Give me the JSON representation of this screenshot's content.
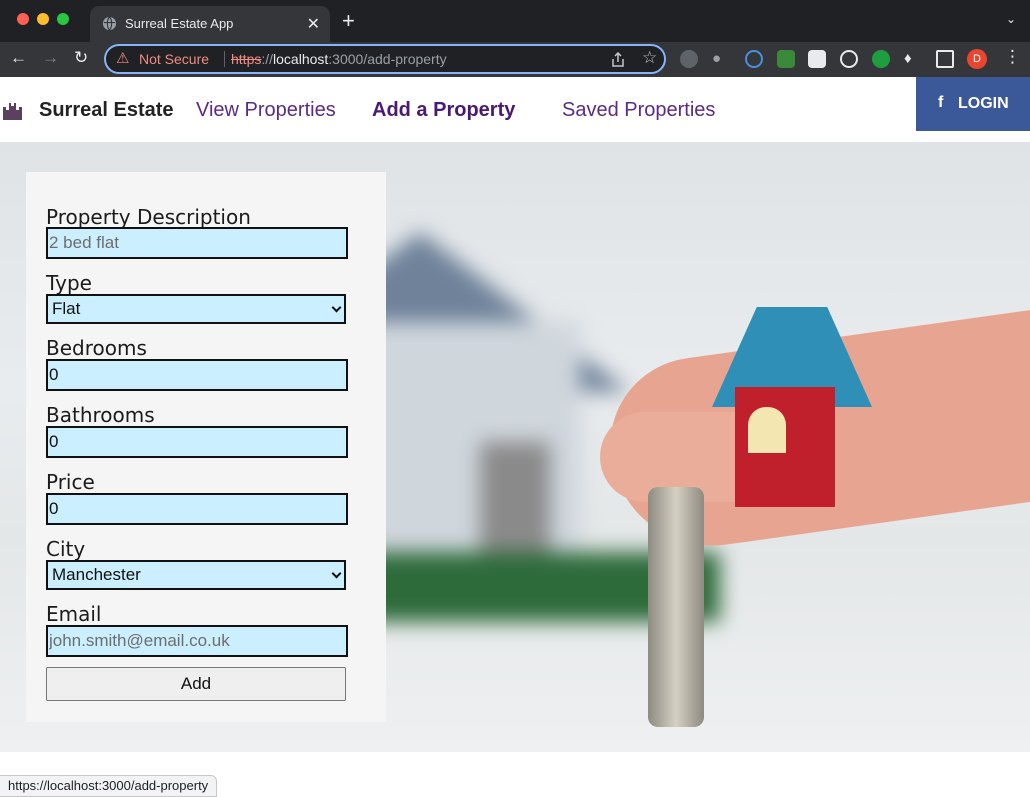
{
  "browser": {
    "tab": {
      "title": "Surreal Estate App",
      "close": "✕"
    },
    "new_tab": "+",
    "tab_menu": "⌄",
    "security_label": "Not Secure",
    "url": {
      "scheme": "https",
      "sep": "://",
      "host": "localhost",
      "rest": ":3000/add-property"
    },
    "profile_initial": "D",
    "status_url": "https://localhost:3000/add-property"
  },
  "nav": {
    "brand": "Surreal Estate",
    "links": [
      {
        "label": "View Properties"
      },
      {
        "label": "Add a Property"
      },
      {
        "label": "Saved Properties"
      }
    ],
    "login": {
      "label": "LOGIN",
      "icon": "f"
    }
  },
  "form": {
    "fields": {
      "description": {
        "label": "Property Description",
        "placeholder": "2 bed flat"
      },
      "type": {
        "label": "Type",
        "value": "Flat"
      },
      "bedrooms": {
        "label": "Bedrooms",
        "value": "0"
      },
      "bathrooms": {
        "label": "Bathrooms",
        "value": "0"
      },
      "price": {
        "label": "Price",
        "value": "0"
      },
      "city": {
        "label": "City",
        "value": "Manchester"
      },
      "email": {
        "label": "Email",
        "placeholder": "john.smith@email.co.uk"
      }
    },
    "submit": "Add"
  },
  "colors": {
    "accent": "#5b2a86",
    "facebook": "#3b5998",
    "input_bg": "#cbefff"
  }
}
